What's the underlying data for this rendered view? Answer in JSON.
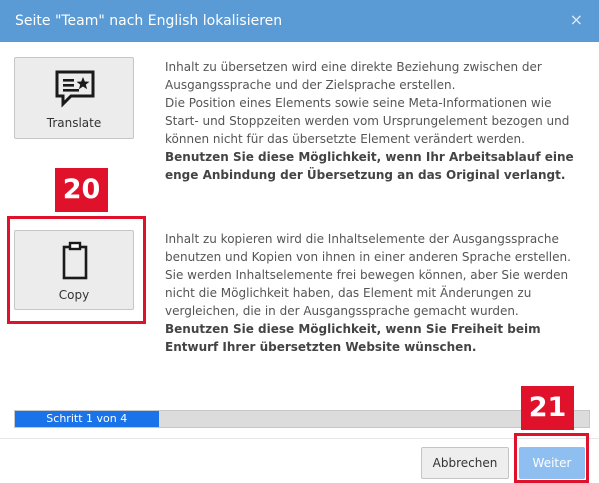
{
  "dialog": {
    "title": "Seite \"Team\" nach English lokalisieren",
    "close_icon": "×"
  },
  "options": {
    "translate": {
      "label": "Translate",
      "icon": "chat-star-icon",
      "text": "Inhalt zu übersetzen wird eine direkte Beziehung zwischen der Ausgangssprache und der Zielsprache erstellen.",
      "text2": "Die Position eines Elements sowie seine Meta-Informationen wie Start- und Stoppzeiten werden vom Ursprungelement bezogen und können nicht für das übersetzte Element verändert werden.",
      "bold": "Benutzen Sie diese Möglichkeit, wenn Ihr Arbeitsablauf eine enge Anbindung der Übersetzung an das Original verlangt."
    },
    "copy": {
      "label": "Copy",
      "icon": "clipboard-icon",
      "text": "Inhalt zu kopieren wird die Inhaltselemente der Ausgangssprache benutzen und Kopien von ihnen in einer anderen Sprache erstellen.",
      "text2": "Sie werden Inhaltselemente frei bewegen können, aber Sie werden nicht die Möglichkeit haben, das Element mit Änderungen zu vergleichen, die in der Ausgangssprache gemacht wurden.",
      "bold": "Benutzen Sie diese Möglichkeit, wenn Sie Freiheit beim Entwurf Ihrer übersetzten Website wünschen."
    }
  },
  "annotations": {
    "copy_number": "20",
    "next_number": "21",
    "color": "#e0112b"
  },
  "progress": {
    "label": "Schritt 1 von 4",
    "fraction": 0.25,
    "color": "#1a73e8"
  },
  "footer": {
    "cancel_label": "Abbrechen",
    "next_label": "Weiter"
  },
  "colors": {
    "titlebar": "#5b9bd5",
    "next_button": "#8fbef0"
  }
}
